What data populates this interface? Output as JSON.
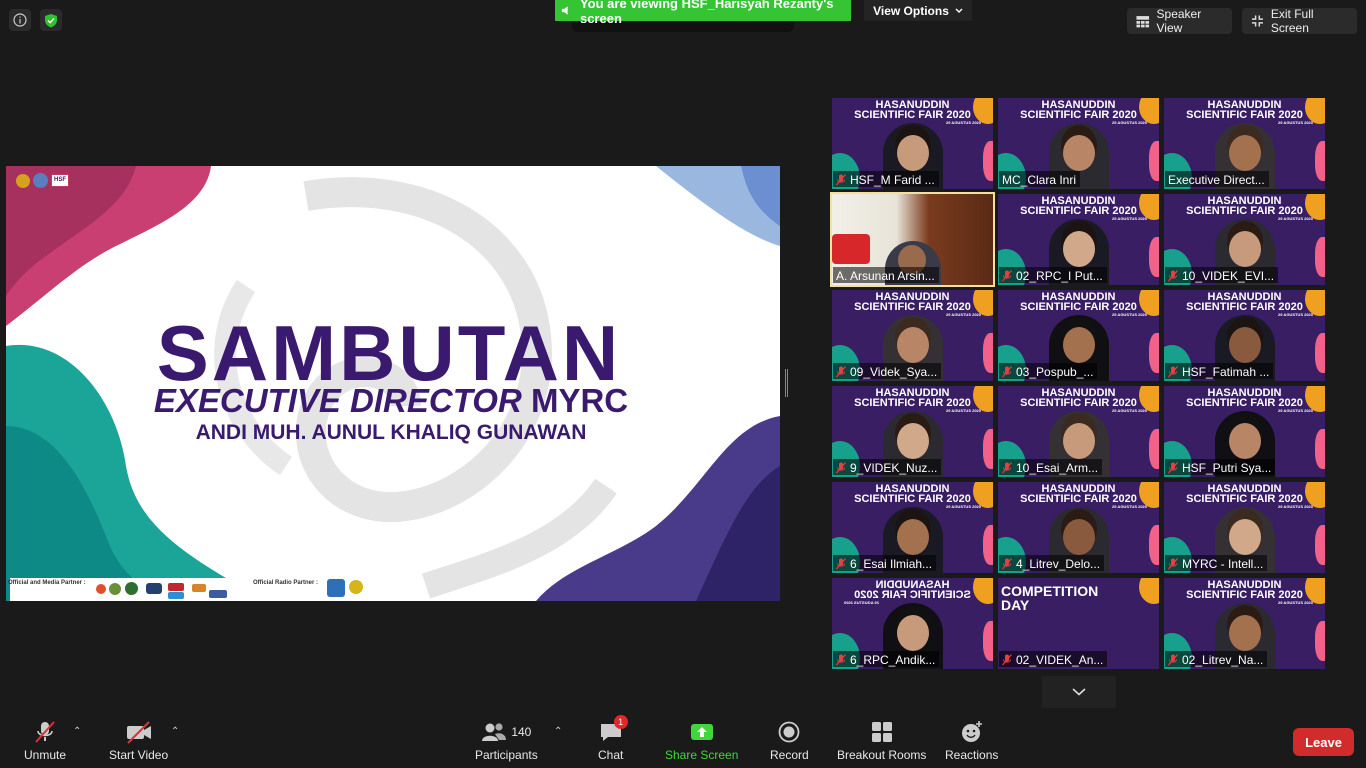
{
  "banner": {
    "viewing_text": "You are viewing HSF_Harisyah Rezanty's screen",
    "view_options_label": "View Options"
  },
  "top_right": {
    "speaker_view_label": "Speaker View",
    "exit_full_screen_label": "Exit Full Screen"
  },
  "slide": {
    "title": "SAMBUTAN",
    "subtitle_italic": "EXECUTIVE DIRECTOR",
    "subtitle_plain": "MYRC",
    "name": "ANDI MUH. AUNUL KHALIQ GUNAWAN",
    "partner_label_1": "Official and Media Partner :",
    "partner_label_2": "Official Radio Partner :",
    "badge": "HSF"
  },
  "tile_header": {
    "line1": "HASANUDDIN",
    "line2": "SCIENTIFIC FAIR 2020",
    "date": "29 AGUSTUS 2020"
  },
  "participants": [
    {
      "name": "HSF_M Farid ...",
      "muted": true
    },
    {
      "name": "MC_Clara Inri",
      "muted": false
    },
    {
      "name": "Executive Direct...",
      "muted": false
    },
    {
      "name": "A. Arsunan Arsin...",
      "muted": false,
      "active": true
    },
    {
      "name": "02_RPC_I Put...",
      "muted": true
    },
    {
      "name": "10_VIDEK_EVI...",
      "muted": true
    },
    {
      "name": "09_Videk_Sya...",
      "muted": true
    },
    {
      "name": "03_Pospub_...",
      "muted": true
    },
    {
      "name": "HSF_Fatimah ...",
      "muted": true
    },
    {
      "name": "9_VIDEK_Nuz...",
      "muted": true
    },
    {
      "name": "10_Esai_Arm...",
      "muted": true
    },
    {
      "name": "HSF_Putri Sya...",
      "muted": true
    },
    {
      "name": "6_Esai Ilmiah...",
      "muted": true
    },
    {
      "name": "4_Litrev_Delo...",
      "muted": true
    },
    {
      "name": "MYRC - Intell...",
      "muted": true
    },
    {
      "name": "6_RPC_Andik...",
      "muted": true
    },
    {
      "name": "02_VIDEK_An...",
      "muted": true
    },
    {
      "name": "02_Litrev_Na...",
      "muted": true
    }
  ],
  "competition_tile": {
    "line1": "COMPETITION",
    "line2": "DAY"
  },
  "toolbar": {
    "unmute_label": "Unmute",
    "start_video_label": "Start Video",
    "participants_label": "Participants",
    "participants_count": "140",
    "chat_label": "Chat",
    "chat_badge": "1",
    "share_screen_label": "Share Screen",
    "record_label": "Record",
    "breakout_label": "Breakout Rooms",
    "reactions_label": "Reactions",
    "leave_label": "Leave"
  },
  "colors": {
    "share_green": "#43d63c",
    "banner_green": "#34c434",
    "leave_red": "#d12b2b",
    "slide_purple": "#3a1a6e",
    "active_border": "#f0e29b"
  }
}
